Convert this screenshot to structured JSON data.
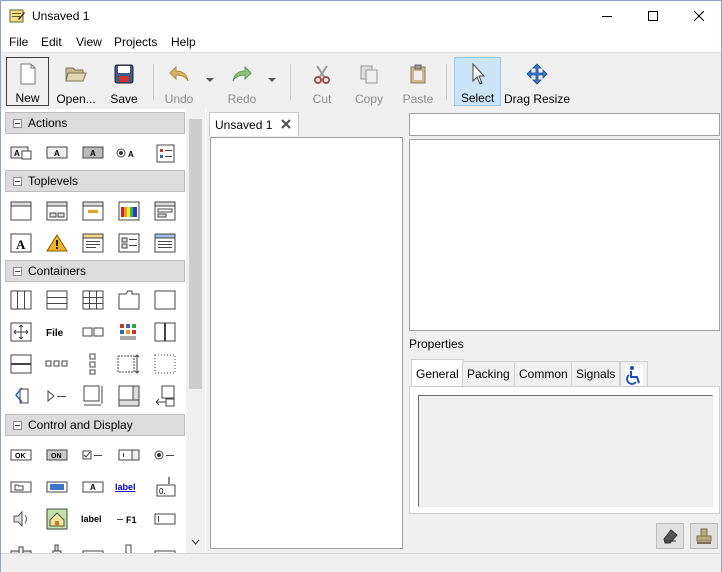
{
  "window": {
    "title": "Unsaved 1"
  },
  "menubar": {
    "items": [
      {
        "label": "File"
      },
      {
        "label": "Edit"
      },
      {
        "label": "View"
      },
      {
        "label": "Projects"
      },
      {
        "label": "Help"
      }
    ]
  },
  "toolbar": {
    "new": "New",
    "open": "Open...",
    "save": "Save",
    "undo": "Undo",
    "redo": "Redo",
    "cut": "Cut",
    "copy": "Copy",
    "paste": "Paste",
    "select": "Select",
    "drag_resize": "Drag Resize"
  },
  "palette": {
    "groups": [
      {
        "label": "Actions"
      },
      {
        "label": "Toplevels"
      },
      {
        "label": "Containers"
      },
      {
        "label": "Control and Display"
      }
    ],
    "glyphs": {
      "ok": "OK",
      "on": "ON",
      "a": "A",
      "file": "File",
      "label": "label",
      "label_link": "label",
      "f1": "F1",
      "zero": "0."
    }
  },
  "editor": {
    "tab_label": "Unsaved 1"
  },
  "inspector": {
    "search_value": ""
  },
  "properties": {
    "label": "Properties",
    "tabs": [
      {
        "label": "General"
      },
      {
        "label": "Packing"
      },
      {
        "label": "Common"
      },
      {
        "label": "Signals"
      }
    ]
  },
  "colors": {
    "accent_pressed": "#cce4f7",
    "link_blue": "#0000cc",
    "accessibility_blue": "#1a4fb0"
  }
}
